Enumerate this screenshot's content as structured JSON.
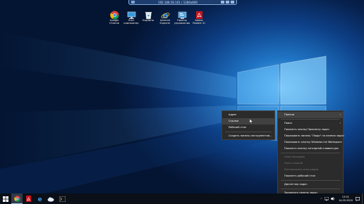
{
  "remote_bar": {
    "title": "192.168.56.101 / 1280x800"
  },
  "desktop_icons": [
    {
      "icon": "chrome-icon",
      "label": "Google\nChrome"
    },
    {
      "icon": "this-pc-icon",
      "label": "Этот\nкомпьютер"
    },
    {
      "icon": "recycle-bin-icon",
      "label": "Корзина"
    },
    {
      "icon": "internet-explorer-icon",
      "label": "Internet\nExplorer"
    },
    {
      "icon": "control-panel-icon",
      "label": "Панель\nуправления"
    },
    {
      "icon": "acrobat-reader-icon",
      "label": "Adobe\nReader XI"
    }
  ],
  "toolbar_submenu": {
    "items": [
      {
        "label": "Адрес",
        "checked": false
      },
      {
        "label": "Ссылки",
        "checked": false,
        "highlighted": true
      },
      {
        "label": "Рабочий стол",
        "checked": false
      },
      {
        "label": "Создать панель инструментов...",
        "separator_before": true
      }
    ]
  },
  "context_menu": {
    "items": [
      {
        "label": "Панели",
        "submenu": true,
        "highlighted": true
      },
      {
        "label": "Поиск",
        "submenu": true,
        "separator_before": true
      },
      {
        "label": "Показать кнопку Просмотр задач"
      },
      {
        "label": "Показывать панель \"Люди\" на панели задач"
      },
      {
        "label": "Показывать кнопку Windows Ink Workspace"
      },
      {
        "label": "Показать кнопку сенсорной клавиатуры"
      },
      {
        "label": "Окна каскадом",
        "disabled": true,
        "separator_before": true
      },
      {
        "label": "Окна стопкой",
        "disabled": true
      },
      {
        "label": "Расположить окна рядом",
        "disabled": true
      },
      {
        "label": "Показать рабочий стол"
      },
      {
        "label": "Диспетчер задач",
        "separator_before": true
      },
      {
        "label": "Закрепить панель задач",
        "separator_before": true
      },
      {
        "label": "Параметры панели задач",
        "gear": true
      }
    ]
  },
  "taskbar": {
    "apps": [
      "windows-start-icon",
      "chrome-icon",
      "acrobat-reader-icon",
      "internet-explorer-icon",
      "cloud-icon",
      "terminal-icon"
    ],
    "clock": {
      "time": "13:01",
      "date": "14.05.2020"
    }
  }
}
